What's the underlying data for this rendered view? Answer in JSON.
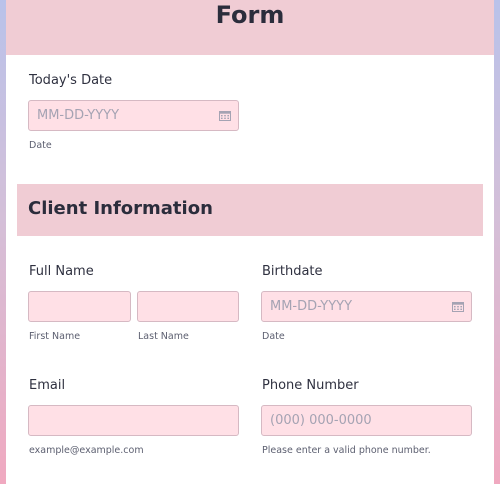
{
  "form": {
    "title": "Form"
  },
  "todays_date": {
    "label": "Today's Date",
    "placeholder": "MM-DD-YYYY",
    "sublabel": "Date"
  },
  "client_section": {
    "title": "Client Information"
  },
  "full_name": {
    "label": "Full Name",
    "first_sublabel": "First Name",
    "last_sublabel": "Last Name"
  },
  "birthdate": {
    "label": "Birthdate",
    "placeholder": "MM-DD-YYYY",
    "sublabel": "Date"
  },
  "email": {
    "label": "Email",
    "sublabel": "example@example.com"
  },
  "phone": {
    "label": "Phone Number",
    "placeholder": "(000) 000-0000",
    "sublabel": "Please enter a valid phone number."
  },
  "icons": {
    "calendar": "calendar-icon"
  },
  "colors": {
    "header_band": "#f0ccd4",
    "input_fill": "#ffe0e6",
    "input_border": "#d6b9c3",
    "background_top": "#b9c2ea",
    "background_bottom": "#f0a9c0"
  }
}
